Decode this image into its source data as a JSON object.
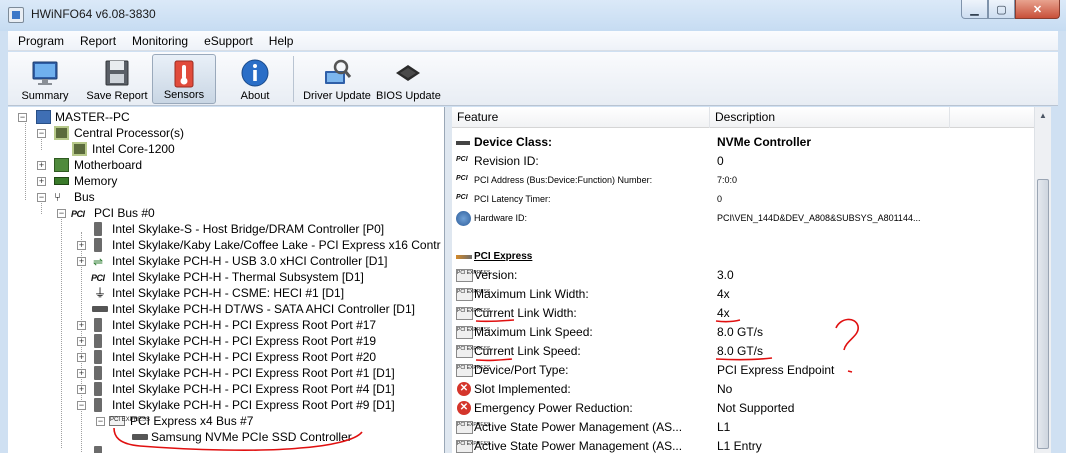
{
  "window": {
    "title": "HWiNFO64 v6.08-3830"
  },
  "menu": [
    "Program",
    "Report",
    "Monitoring",
    "eSupport",
    "Help"
  ],
  "toolbar": {
    "summary": "Summary",
    "save_report": "Save Report",
    "sensors": "Sensors",
    "about": "About",
    "driver_update": "Driver Update",
    "bios_update": "BIOS Update"
  },
  "tree": {
    "root": "MASTER--PC",
    "cpu_group": "Central Processor(s)",
    "cpu": "Intel Core-1200",
    "motherboard": "Motherboard",
    "memory": "Memory",
    "bus": "Bus",
    "pci_bus": "PCI Bus #0",
    "items": [
      "Intel Skylake-S - Host Bridge/DRAM Controller [P0]",
      "Intel Skylake/Kaby Lake/Coffee Lake - PCI Express x16 Contr",
      "Intel Skylake PCH-H - USB 3.0 xHCI Controller [D1]",
      "Intel Skylake PCH-H - Thermal Subsystem [D1]",
      "Intel Skylake PCH-H - CSME: HECI #1 [D1]",
      "Intel Skylake PCH-H DT/WS - SATA AHCI Controller [D1]",
      "Intel Skylake PCH-H - PCI Express Root Port #17",
      "Intel Skylake PCH-H - PCI Express Root Port #19",
      "Intel Skylake PCH-H - PCI Express Root Port #20",
      "Intel Skylake PCH-H - PCI Express Root Port #1 [D1]",
      "Intel Skylake PCH-H - PCI Express Root Port #4 [D1]",
      "Intel Skylake PCH-H - PCI Express Root Port #9 [D1]"
    ],
    "pcie_bus": "PCI Express x4 Bus #7",
    "ssd": "Samsung NVMe PCIe SSD Controller"
  },
  "list": {
    "col_feature": "Feature",
    "col_description": "Description",
    "rows": [
      {
        "feature": "Device Class:",
        "value": "NVMe Controller"
      },
      {
        "feature": "Revision ID:",
        "value": "0"
      },
      {
        "feature": "PCI Address (Bus:Device:Function) Number:",
        "value": "7:0:0"
      },
      {
        "feature": "PCI Latency Timer:",
        "value": "0"
      },
      {
        "feature": "Hardware ID:",
        "value": "PCI\\VEN_144D&DEV_A808&SUBSYS_A801144..."
      },
      {
        "feature": "PCI Express",
        "value": ""
      },
      {
        "feature": "Version:",
        "value": "3.0"
      },
      {
        "feature": "Maximum Link Width:",
        "value": "4x"
      },
      {
        "feature": "Current Link Width:",
        "value": "4x"
      },
      {
        "feature": "Maximum Link Speed:",
        "value": "8.0 GT/s"
      },
      {
        "feature": "Current Link Speed:",
        "value": "8.0 GT/s"
      },
      {
        "feature": "Device/Port Type:",
        "value": "PCI Express Endpoint"
      },
      {
        "feature": "Slot Implemented:",
        "value": "No"
      },
      {
        "feature": "Emergency Power Reduction:",
        "value": "Not Supported"
      },
      {
        "feature": "Active State Power Management (AS...",
        "value": "L1"
      },
      {
        "feature": "Active State Power Management (AS...",
        "value": "L1 Entry"
      }
    ]
  },
  "annotation": {
    "mark": "?",
    "color": "#e01010"
  },
  "icons": {
    "pci": "PCI",
    "pcie": "PCI EXPRESS"
  }
}
